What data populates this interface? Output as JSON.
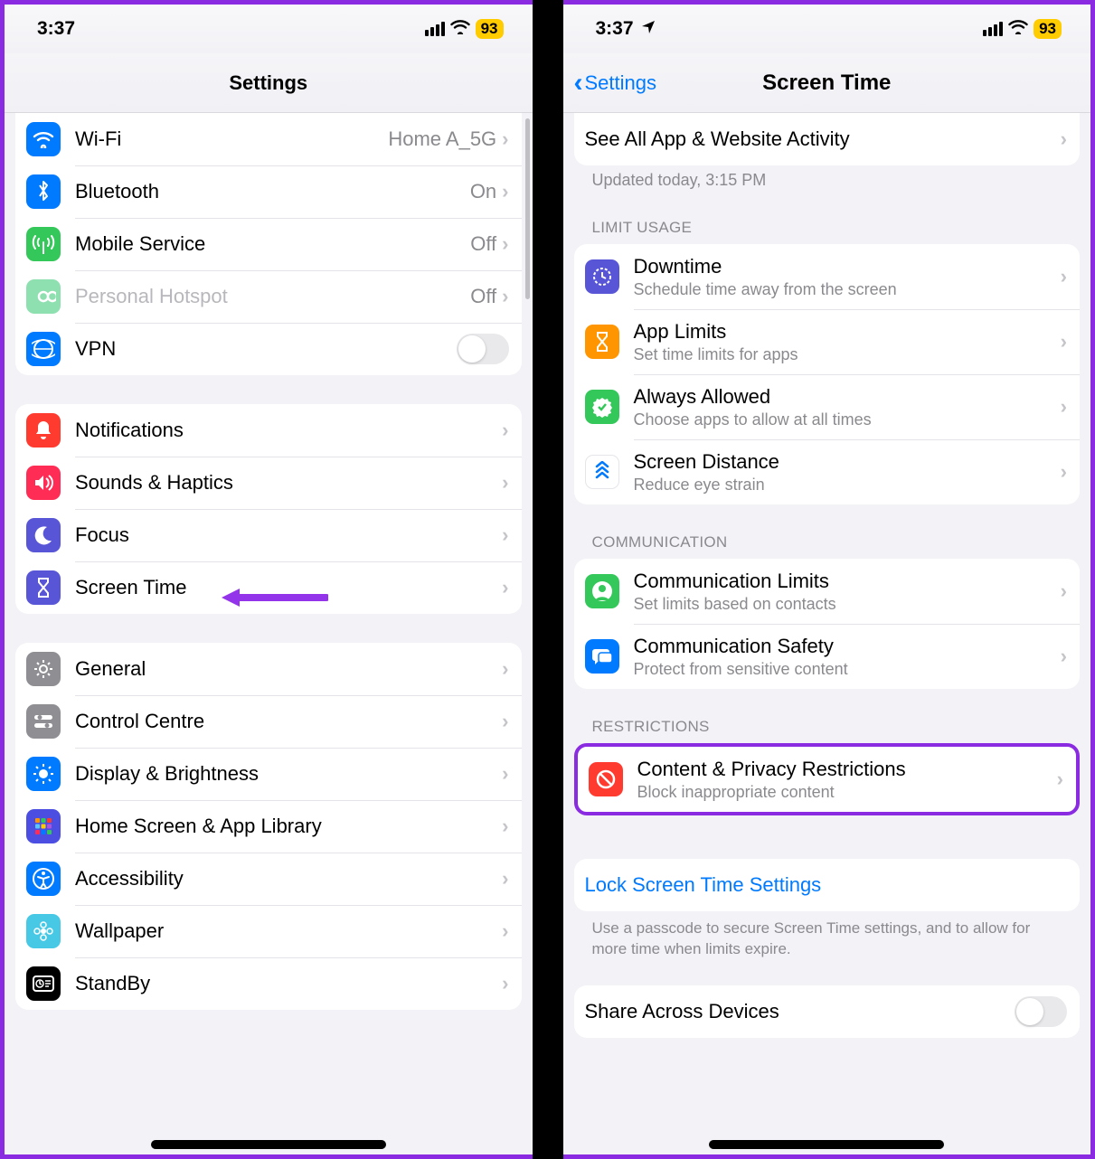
{
  "status": {
    "time": "3:37",
    "battery": "93"
  },
  "left": {
    "title": "Settings",
    "g1": [
      {
        "id": "wifi",
        "label": "Wi-Fi",
        "value": "Home A_5G",
        "bg": "#007aff",
        "chev": true
      },
      {
        "id": "bluetooth",
        "label": "Bluetooth",
        "value": "On",
        "bg": "#007aff",
        "chev": true
      },
      {
        "id": "mobile",
        "label": "Mobile Service",
        "value": "Off",
        "bg": "#34c759",
        "chev": true
      },
      {
        "id": "hotspot",
        "label": "Personal Hotspot",
        "value": "Off",
        "bg": "#8fe0b0",
        "chev": true,
        "disabled": true
      },
      {
        "id": "vpn",
        "label": "VPN",
        "bg": "#007aff",
        "toggle": true
      }
    ],
    "g2": [
      {
        "id": "notifications",
        "label": "Notifications",
        "bg": "#ff3b30"
      },
      {
        "id": "sounds",
        "label": "Sounds & Haptics",
        "bg": "#ff2d55"
      },
      {
        "id": "focus",
        "label": "Focus",
        "bg": "#5856d6"
      },
      {
        "id": "screentime",
        "label": "Screen Time",
        "bg": "#5856d6"
      }
    ],
    "g3": [
      {
        "id": "general",
        "label": "General",
        "bg": "#8e8e93"
      },
      {
        "id": "control",
        "label": "Control Centre",
        "bg": "#8e8e93"
      },
      {
        "id": "display",
        "label": "Display & Brightness",
        "bg": "#007aff"
      },
      {
        "id": "homescreen",
        "label": "Home Screen & App Library",
        "bg": "#4b4ee0"
      },
      {
        "id": "accessibility",
        "label": "Accessibility",
        "bg": "#007aff"
      },
      {
        "id": "wallpaper",
        "label": "Wallpaper",
        "bg": "#47c8e5"
      },
      {
        "id": "standby",
        "label": "StandBy",
        "bg": "#000"
      }
    ]
  },
  "right": {
    "back": "Settings",
    "title": "Screen Time",
    "activity_label": "See All App & Website Activity",
    "updated": "Updated today, 3:15 PM",
    "section_limit": "LIMIT USAGE",
    "limit": [
      {
        "id": "downtime",
        "label": "Downtime",
        "sub": "Schedule time away from the screen",
        "bg": "#5856d6"
      },
      {
        "id": "applimits",
        "label": "App Limits",
        "sub": "Set time limits for apps",
        "bg": "#ff9500"
      },
      {
        "id": "always",
        "label": "Always Allowed",
        "sub": "Choose apps to allow at all times",
        "bg": "#34c759"
      },
      {
        "id": "distance",
        "label": "Screen Distance",
        "sub": "Reduce eye strain",
        "nobg": true,
        "fg": "#007aff"
      }
    ],
    "section_comm": "COMMUNICATION",
    "comm": [
      {
        "id": "commlimits",
        "label": "Communication Limits",
        "sub": "Set limits based on contacts",
        "bg": "#34c759"
      },
      {
        "id": "commsafety",
        "label": "Communication Safety",
        "sub": "Protect from sensitive content",
        "bg": "#007aff"
      }
    ],
    "section_restrict": "RESTRICTIONS",
    "restrict": {
      "label": "Content & Privacy Restrictions",
      "sub": "Block inappropriate content",
      "bg": "#ff3b30"
    },
    "lock_label": "Lock Screen Time Settings",
    "lock_note": "Use a passcode to secure Screen Time settings, and to allow for more time when limits expire.",
    "share_label": "Share Across Devices"
  }
}
